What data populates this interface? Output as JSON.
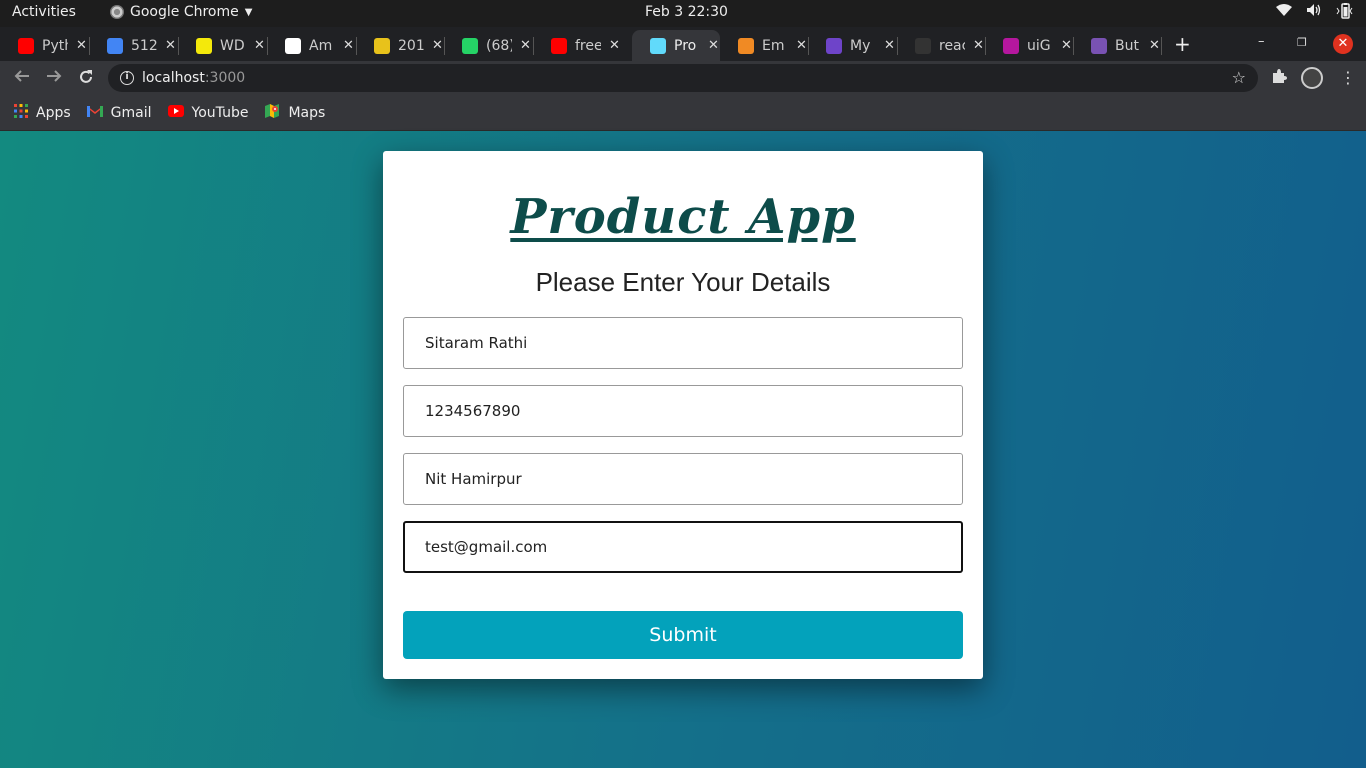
{
  "topbar": {
    "activities": "Activities",
    "app_name": "Google Chrome",
    "clock": "Feb 3  22:30"
  },
  "tabs": [
    {
      "title": "Pyth",
      "favicon_color": "#ff0000",
      "icon": "youtube-icon"
    },
    {
      "title": "512",
      "favicon_color": "#4285f4",
      "icon": "google-icon"
    },
    {
      "title": "WD",
      "favicon_color": "#f4e90b",
      "icon": "wd-icon"
    },
    {
      "title": "Am",
      "favicon_color": "#ffffff",
      "icon": "amazon-icon"
    },
    {
      "title": "201",
      "favicon_color": "#e8c21b",
      "icon": "lemon-icon"
    },
    {
      "title": "(68)",
      "favicon_color": "#25d366",
      "icon": "whatsapp-icon"
    },
    {
      "title": "free",
      "favicon_color": "#ff0000",
      "icon": "youtube-icon"
    },
    {
      "title": "Pro",
      "favicon_color": "#61dafb",
      "icon": "react-icon",
      "active": true
    },
    {
      "title": "Em",
      "favicon_color": "#f08a24",
      "icon": "ember-icon"
    },
    {
      "title": "My",
      "favicon_color": "#6e44c9",
      "icon": "my-icon"
    },
    {
      "title": "reac",
      "favicon_color": "#333333",
      "icon": "github-icon"
    },
    {
      "title": "uiG",
      "favicon_color": "#b5179e",
      "icon": "uigradients-icon"
    },
    {
      "title": "But",
      "favicon_color": "#7952b3",
      "icon": "bootstrap-icon"
    }
  ],
  "address_bar": {
    "host": "localhost",
    "port": ":3000"
  },
  "bookmarks": [
    {
      "label": "Apps",
      "icon": "apps-grid-icon"
    },
    {
      "label": "Gmail",
      "icon": "gmail-icon"
    },
    {
      "label": "YouTube",
      "icon": "youtube-icon"
    },
    {
      "label": "Maps",
      "icon": "maps-icon"
    }
  ],
  "form": {
    "title": "Product App",
    "subtitle": "Please Enter Your Details",
    "name_value": "Sitaram Rathi",
    "phone_value": "1234567890",
    "college_value": "Nit Hamirpur",
    "email_value": "test@gmail.com",
    "submit_label": "Submit"
  },
  "colors": {
    "accent": "#03a2bb",
    "title": "#0d4c4a",
    "bg_start": "#138a80",
    "bg_end": "#125e8c"
  }
}
